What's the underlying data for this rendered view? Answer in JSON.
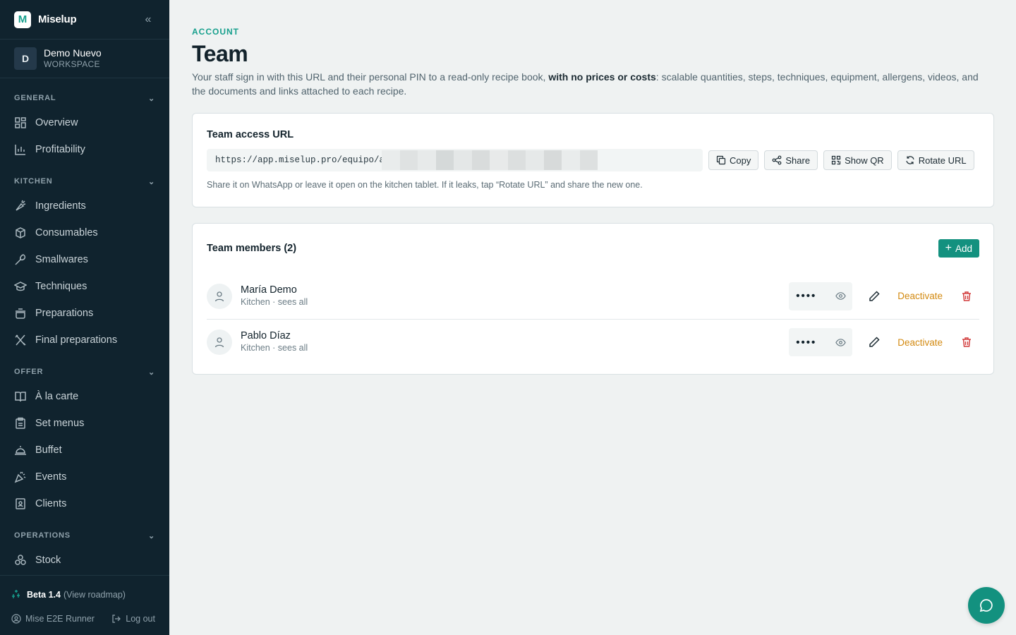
{
  "brand": {
    "logo_letter": "M",
    "name": "Miselup"
  },
  "workspace": {
    "initial": "D",
    "name": "Demo Nuevo",
    "label": "WORKSPACE"
  },
  "sidebar": {
    "sections": [
      {
        "title": "GENERAL",
        "items": [
          {
            "label": "Overview",
            "icon": "grid-icon"
          },
          {
            "label": "Profitability",
            "icon": "bar-chart-icon"
          }
        ]
      },
      {
        "title": "KITCHEN",
        "items": [
          {
            "label": "Ingredients",
            "icon": "carrot-icon"
          },
          {
            "label": "Consumables",
            "icon": "box-icon"
          },
          {
            "label": "Smallwares",
            "icon": "utensils-icon"
          },
          {
            "label": "Techniques",
            "icon": "graduation-cap-icon"
          },
          {
            "label": "Preparations",
            "icon": "pot-icon"
          },
          {
            "label": "Final preparations",
            "icon": "fork-knife-icon"
          }
        ]
      },
      {
        "title": "OFFER",
        "items": [
          {
            "label": "À la carte",
            "icon": "book-icon"
          },
          {
            "label": "Set menus",
            "icon": "clipboard-icon"
          },
          {
            "label": "Buffet",
            "icon": "cloche-icon"
          },
          {
            "label": "Events",
            "icon": "party-icon"
          },
          {
            "label": "Clients",
            "icon": "contact-icon"
          }
        ]
      },
      {
        "title": "OPERATIONS",
        "items": [
          {
            "label": "Stock",
            "icon": "boxes-icon"
          }
        ]
      }
    ],
    "footer": {
      "beta": "Beta 1.4",
      "roadmap": "(View roadmap)",
      "user": "Mise E2E Runner",
      "logout": "Log out"
    }
  },
  "page": {
    "eyebrow": "ACCOUNT",
    "title": "Team",
    "desc_1": "Your staff sign in with this URL and their personal PIN to a read-only recipe book, ",
    "desc_bold": "with no prices or costs",
    "desc_2": ": scalable quantities, steps, techniques, equipment, allergens, videos, and the documents and links attached to each recipe."
  },
  "access": {
    "title": "Team access URL",
    "url": "https://app.miselup.pro/equipo/ac",
    "buttons": {
      "copy": "Copy",
      "share": "Share",
      "qr": "Show QR",
      "rotate": "Rotate URL"
    },
    "helper": "Share it on WhatsApp or leave it open on the kitchen tablet. If it leaks, tap “Rotate URL” and share the new one."
  },
  "members": {
    "title": "Team members (2)",
    "add_label": "Add",
    "deactivate_label": "Deactivate",
    "pin_mask": "••••",
    "list": [
      {
        "name": "María Demo",
        "role": "Kitchen · sees all"
      },
      {
        "name": "Pablo Díaz",
        "role": "Kitchen · sees all"
      }
    ]
  },
  "colors": {
    "accent": "#13917f",
    "sidebar": "#10232e",
    "warning": "#d38a11",
    "danger": "#d23b3b"
  }
}
